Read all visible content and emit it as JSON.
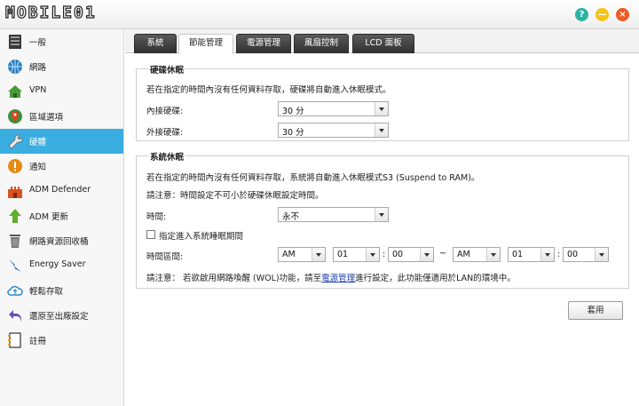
{
  "app": {
    "logo_text": "MOBILE01",
    "help_glyph": "?",
    "minimize_glyph": "—",
    "close_glyph": "×"
  },
  "sidebar": {
    "items": [
      {
        "label": "一般",
        "icon": "server-icon"
      },
      {
        "label": "網路",
        "icon": "globe-icon"
      },
      {
        "label": "VPN",
        "icon": "house-icon"
      },
      {
        "label": "區域選項",
        "icon": "region-icon"
      },
      {
        "label": "硬體",
        "icon": "wrench-icon",
        "active": true
      },
      {
        "label": "通知",
        "icon": "alert-icon"
      },
      {
        "label": "ADM Defender",
        "icon": "castle-icon"
      },
      {
        "label": "ADM 更新",
        "icon": "arrow-up-icon"
      },
      {
        "label": "網路資源回收桶",
        "icon": "trash-icon"
      },
      {
        "label": "Energy Saver",
        "icon": "lightning-icon"
      },
      {
        "label": "輕鬆存取",
        "icon": "cloud-icon"
      },
      {
        "label": "還原至出廠設定",
        "icon": "undo-icon"
      },
      {
        "label": "註冊",
        "icon": "register-icon"
      }
    ]
  },
  "tabs": [
    {
      "label": "系統"
    },
    {
      "label": "節能管理",
      "active": true
    },
    {
      "label": "電源管理"
    },
    {
      "label": "風扇控制"
    },
    {
      "label": "LCD 面板"
    }
  ],
  "disk_sleep": {
    "title": "硬碟休眠",
    "description": "若在指定的時間內沒有任何資料存取，硬碟將自動進入休眠模式。",
    "internal_label": "內接硬碟:",
    "internal_value": "30 分",
    "external_label": "外接硬碟:",
    "external_value": "30 分"
  },
  "system_sleep": {
    "title": "系統休眠",
    "description": "若在指定的時間內沒有任何資料存取，系統將自動進入休眠模式S3 (Suspend to RAM)。",
    "note": "請注意：時間設定不可小於硬碟休眠設定時間。",
    "time_label": "時間:",
    "time_value": "永不",
    "schedule_checkbox_label": "指定進入系統睡眠期間",
    "schedule_checked": false,
    "interval_label": "時間區間:",
    "start": {
      "ampm": "AM",
      "hour": "01",
      "minute": "00"
    },
    "end": {
      "ampm": "AM",
      "hour": "01",
      "minute": "00"
    },
    "colon": ":",
    "tilde": "~",
    "wol_note_prefix": "請注意： 若欲啟用網路喚醒 (WOL)功能，請至",
    "wol_note_link": "電源管理",
    "wol_note_suffix": "進行設定，此功能僅適用於LAN的環境中。"
  },
  "apply_button": "套用",
  "colors": {
    "accent": "#3aaee0",
    "tab_dark": "#2f2f2f",
    "link": "#1a3fb0"
  }
}
